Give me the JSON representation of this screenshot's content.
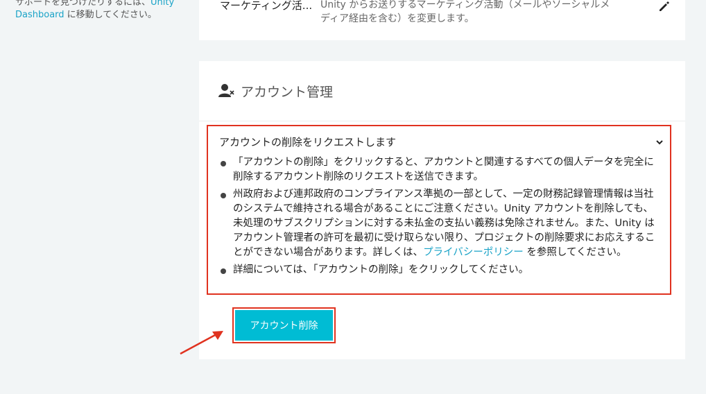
{
  "sidebar": {
    "text_line1": "サポートを見つけたりするには、",
    "link_unity": "Unity",
    "link_dashboard": "Dashboard",
    "text_line2": " に移動してください。"
  },
  "marketing": {
    "label": "マーケティング活...",
    "description": "Unity からお送りするマーケティング活動（メールやソーシャルメディア経由を含む）を変更します。",
    "edit_icon": "pencil-icon"
  },
  "account": {
    "title": "アカウント管理",
    "icon": "user-remove-icon",
    "accordion_title": "アカウントの削除をリクエストします",
    "bullet1": "「アカウントの削除」をクリックすると、アカウントと関連するすべての個人データを完全に削除するアカウント削除のリクエストを送信できます。",
    "bullet2_text": "州政府および連邦政府のコンプライアンス準拠の一部として、一定の財務記録管理情報は当社のシステムで維持される場合があることにご注意ください。Unity アカウントを削除しても、未処理のサブスクリプションに対する未払金の支払い義務は免除されません。また、Unity はアカウント管理者の許可を最初に受け取らない限り、プロジェクトの削除要求にお応えすることができない場合があります。詳しくは、",
    "bullet2_link": "プライバシーポリシー",
    "bullet2_suffix": " を参照してください。",
    "bullet3": "詳細については、「アカウントの削除」をクリックしてください。",
    "delete_button": "アカウント削除"
  },
  "colors": {
    "accent": "#00bcd4",
    "highlight": "#e0321f",
    "link": "#1aa3c7"
  }
}
